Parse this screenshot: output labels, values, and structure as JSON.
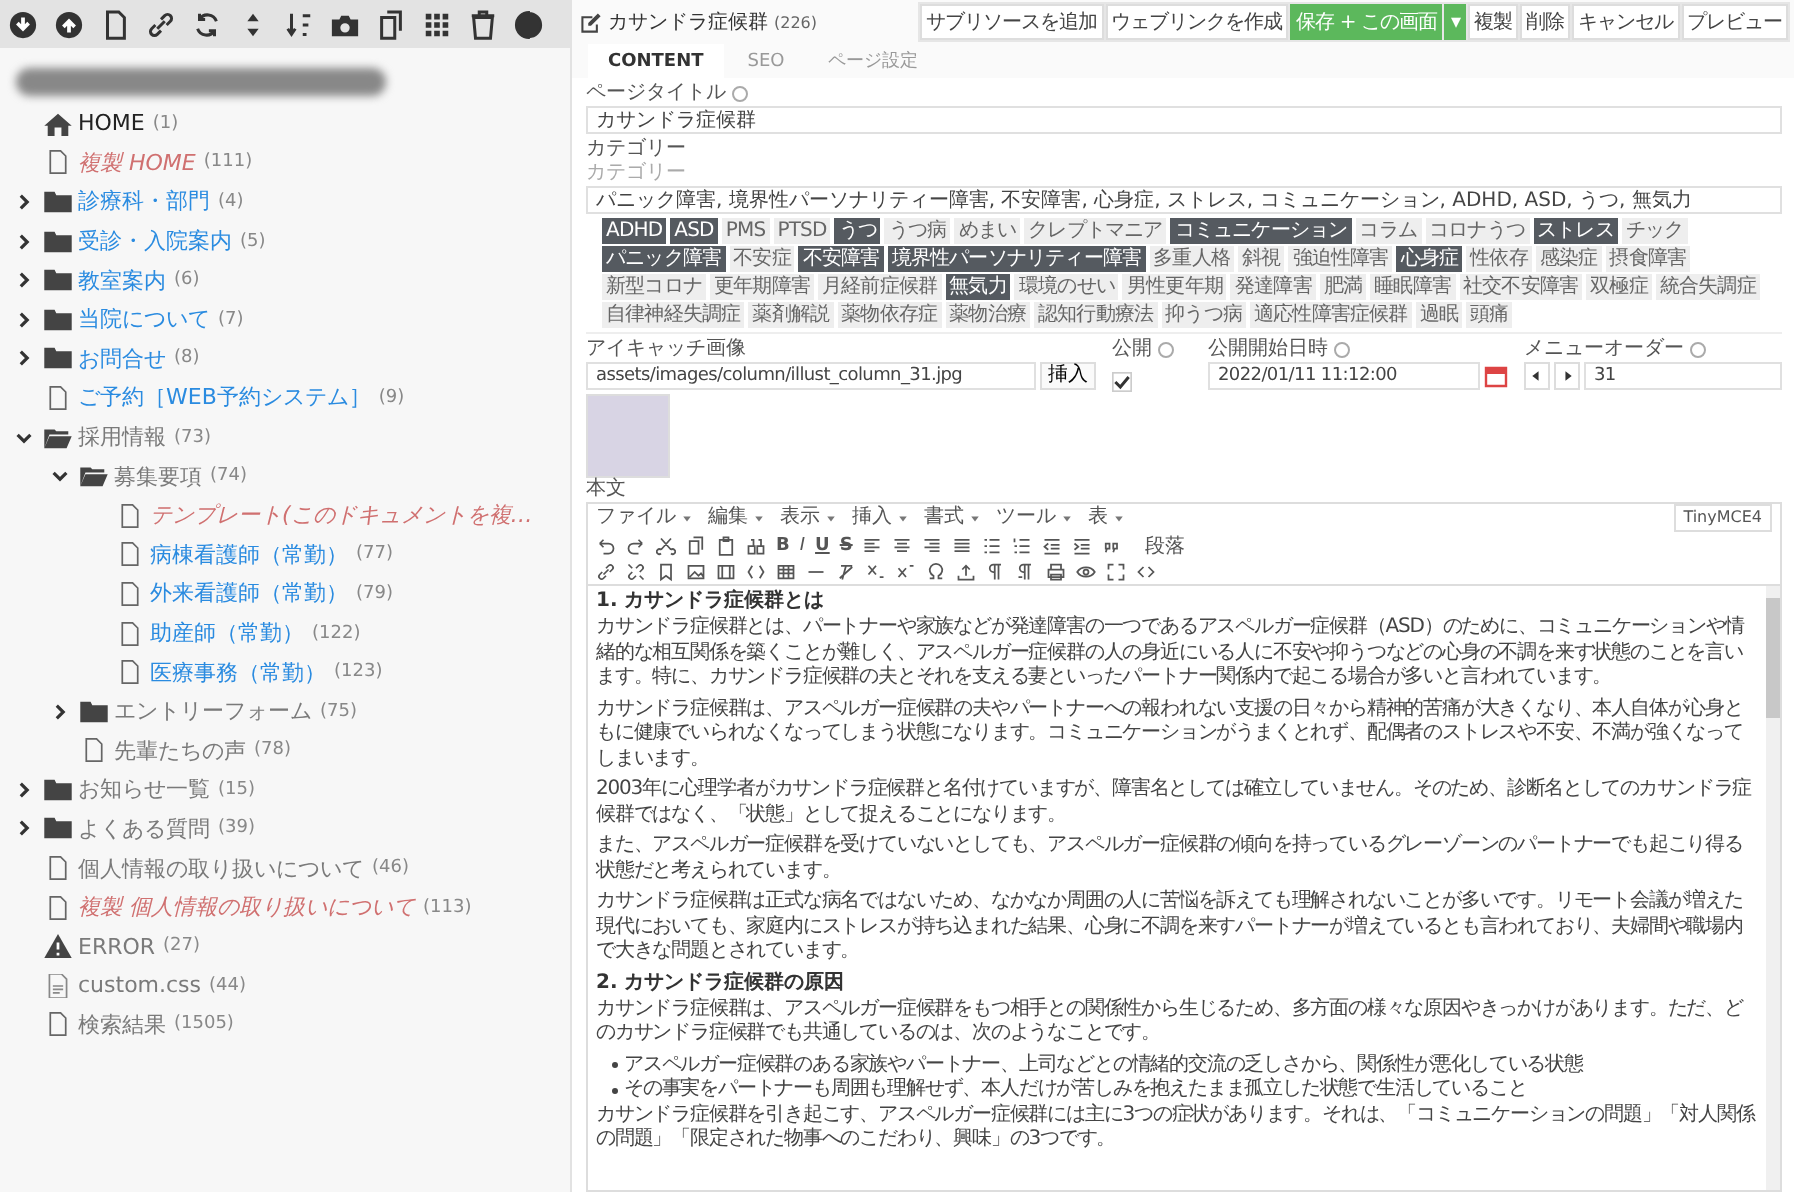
{
  "tree": [
    {
      "label": "HOME",
      "id": "(1)",
      "kind": "home",
      "unpublished": false,
      "hidden": false
    },
    {
      "label": "複製 HOME",
      "id": "(111)",
      "kind": "doc",
      "unpublished": true,
      "hidden": false
    },
    {
      "label": "診療科・部門",
      "id": "(4)",
      "kind": "folder",
      "unpublished": false,
      "hidden": false,
      "expanded": false
    },
    {
      "label": "受診・入院案内",
      "id": "(5)",
      "kind": "folder",
      "unpublished": false,
      "hidden": false,
      "expanded": false
    },
    {
      "label": "教室案内",
      "id": "(6)",
      "kind": "folder",
      "unpublished": false,
      "hidden": false,
      "expanded": false
    },
    {
      "label": "当院について",
      "id": "(7)",
      "kind": "folder",
      "unpublished": false,
      "hidden": false,
      "expanded": false
    },
    {
      "label": "お問合せ",
      "id": "(8)",
      "kind": "folder",
      "unpublished": false,
      "hidden": false,
      "expanded": false
    },
    {
      "label": "ご予約［WEB予約システム］",
      "id": "(9)",
      "kind": "doc",
      "unpublished": false,
      "hidden": false
    },
    {
      "label": "採用情報",
      "id": "(73)",
      "kind": "folder",
      "unpublished": false,
      "hidden": true,
      "expanded": true,
      "children": [
        {
          "label": "募集要項",
          "id": "(74)",
          "kind": "folder",
          "unpublished": false,
          "hidden": true,
          "expanded": true,
          "children": [
            {
              "label": "テンプレート(このドキュメントを複…",
              "kind": "doc",
              "unpublished": true,
              "hidden": false
            },
            {
              "label": "病棟看護師（常勤）",
              "id": "(77)",
              "kind": "doc",
              "unpublished": false,
              "hidden": false
            },
            {
              "label": "外来看護師（常勤）",
              "id": "(79)",
              "kind": "doc",
              "unpublished": false,
              "hidden": false
            },
            {
              "label": "助産師（常勤）",
              "id": "(122)",
              "kind": "doc",
              "unpublished": false,
              "hidden": false
            },
            {
              "label": "医療事務（常勤）",
              "id": "(123)",
              "kind": "doc",
              "unpublished": false,
              "hidden": false
            }
          ]
        },
        {
          "label": "エントリーフォーム",
          "id": "(75)",
          "kind": "folder",
          "unpublished": false,
          "hidden": true,
          "expanded": false
        },
        {
          "label": "先輩たちの声",
          "id": "(78)",
          "kind": "doc",
          "unpublished": false,
          "hidden": true
        }
      ]
    },
    {
      "label": "お知らせ一覧",
      "id": "(15)",
      "kind": "folder",
      "unpublished": false,
      "hidden": true,
      "expanded": false
    },
    {
      "label": "よくある質問",
      "id": "(39)",
      "kind": "folder",
      "unpublished": false,
      "hidden": true,
      "expanded": false
    },
    {
      "label": "個人情報の取り扱いについて",
      "id": "(46)",
      "kind": "doc",
      "unpublished": false,
      "hidden": true
    },
    {
      "label": "複製 個人情報の取り扱いについて",
      "id": "(113)",
      "kind": "doc",
      "unpublished": true,
      "hidden": false
    },
    {
      "label": "ERROR",
      "id": "(27)",
      "kind": "error",
      "unpublished": false,
      "hidden": true
    },
    {
      "label": "custom.css",
      "id": "(44)",
      "kind": "file",
      "unpublished": false,
      "hidden": true
    },
    {
      "label": "検索結果",
      "id": "(1505)",
      "kind": "doc",
      "unpublished": false,
      "hidden": true
    }
  ],
  "header": {
    "title": "カサンドラ症候群",
    "id": "(226)"
  },
  "actions": [
    {
      "label": "サブリソースを追加",
      "kind": "plain"
    },
    {
      "label": "ウェブリンクを作成",
      "kind": "plain"
    },
    {
      "label": "保存 + この画面",
      "kind": "primary"
    },
    {
      "label": "▾",
      "kind": "primary"
    },
    {
      "label": "複製",
      "kind": "plain"
    },
    {
      "label": "削除",
      "kind": "plain"
    },
    {
      "label": "キャンセル",
      "kind": "plain"
    },
    {
      "label": "プレビュー",
      "kind": "plain"
    }
  ],
  "tabs": [
    {
      "label": "CONTENT",
      "selected": true
    },
    {
      "label": "SEO",
      "selected": false
    },
    {
      "label": "ページ設定",
      "selected": false
    }
  ],
  "page_title": {
    "label": "ページタイトル",
    "value": "カサンドラ症候群"
  },
  "category": {
    "label": "カテゴリー",
    "sublabel": "カテゴリー",
    "value": "パニック障害, 境界性パーソナリティー障害, 不安障害, 心身症, ストレス, コミュニケーション, ADHD, ASD, うつ, 無気力",
    "tags": [
      {
        "label": "ADHD",
        "selected": true
      },
      {
        "label": "ASD",
        "selected": true
      },
      {
        "label": "PMS",
        "selected": false
      },
      {
        "label": "PTSD",
        "selected": false
      },
      {
        "label": "うつ",
        "selected": true
      },
      {
        "label": "うつ病",
        "selected": false
      },
      {
        "label": "めまい",
        "selected": false
      },
      {
        "label": "クレプトマニア",
        "selected": false
      },
      {
        "label": "コミュニケーション",
        "selected": true
      },
      {
        "label": "コラム",
        "selected": false
      },
      {
        "label": "コロナうつ",
        "selected": false
      },
      {
        "label": "ストレス",
        "selected": true
      },
      {
        "label": "チック",
        "selected": false
      },
      {
        "label": "パニック障害",
        "selected": true
      },
      {
        "label": "不安症",
        "selected": false
      },
      {
        "label": "不安障害",
        "selected": true
      },
      {
        "label": "境界性パーソナリティー障害",
        "selected": true
      },
      {
        "label": "多重人格",
        "selected": false
      },
      {
        "label": "斜視",
        "selected": false
      },
      {
        "label": "強迫性障害",
        "selected": false
      },
      {
        "label": "心身症",
        "selected": true
      },
      {
        "label": "性依存",
        "selected": false
      },
      {
        "label": "感染症",
        "selected": false
      },
      {
        "label": "摂食障害",
        "selected": false
      },
      {
        "label": "新型コロナ",
        "selected": false
      },
      {
        "label": "更年期障害",
        "selected": false
      },
      {
        "label": "月経前症候群",
        "selected": false
      },
      {
        "label": "無気力",
        "selected": true
      },
      {
        "label": "環境のせい",
        "selected": false
      },
      {
        "label": "男性更年期",
        "selected": false
      },
      {
        "label": "発達障害",
        "selected": false
      },
      {
        "label": "肥満",
        "selected": false
      },
      {
        "label": "睡眠障害",
        "selected": false
      },
      {
        "label": "社交不安障害",
        "selected": false
      },
      {
        "label": "双極症",
        "selected": false
      },
      {
        "label": "統合失調症",
        "selected": false
      },
      {
        "label": "自律神経失調症",
        "selected": false
      },
      {
        "label": "薬剤解説",
        "selected": false
      },
      {
        "label": "薬物依存症",
        "selected": false
      },
      {
        "label": "薬物治療",
        "selected": false
      },
      {
        "label": "認知行動療法",
        "selected": false
      },
      {
        "label": "抑うつ病",
        "selected": false
      },
      {
        "label": "適応性障害症候群",
        "selected": false
      },
      {
        "label": "過眠",
        "selected": false
      },
      {
        "label": "頭痛",
        "selected": false
      }
    ]
  },
  "image": {
    "label": "アイキャッチ画像",
    "value": "assets/images/column/illust_column_31.jpg",
    "button": "挿入"
  },
  "published": {
    "label": "公開",
    "checked": true
  },
  "pub_date": {
    "label": "公開開始日時",
    "value": "2022/01/11 11:12:00"
  },
  "menu_order": {
    "label": "メニューオーダー",
    "value": "31"
  },
  "editor": {
    "label": "本文",
    "menus": [
      "ファイル",
      "編集",
      "表示",
      "挿入",
      "書式",
      "ツール",
      "表"
    ],
    "switcher": "TinyMCE4",
    "format": "段落",
    "text_tools": [
      "B",
      "I",
      "U",
      "S"
    ],
    "content": [
      {
        "kind": "h",
        "text": "1. カサンドラ症候群とは"
      },
      {
        "kind": "p",
        "text": "カサンドラ症候群とは、パートナーや家族などが発達障害の一つであるアスペルガー症候群（ASD）のために、コミュニケーションや情緒的な相互関係を築くことが難しく、アスペルガー症候群の人の身近にいる人に不安や抑うつなどの心身の不調を来す状態のことを言います。特に、カサンドラ症候群の夫とそれを支える妻といったパートナー関係内で起こる場合が多いと言われています。"
      },
      {
        "kind": "p",
        "text": "カサンドラ症候群は、アスペルガー症候群の夫やパートナーへの報われない支援の日々から精神的苦痛が大きくなり、本人自体が心身ともに健康でいられなくなってしまう状態になります。コミュニケーションがうまくとれず、配偶者のストレスや不安、不満が強くなってしまいます。"
      },
      {
        "kind": "p",
        "text": "2003年に心理学者がカサンドラ症候群と名付けていますが、障害名としては確立していません。そのため、診断名としてのカサンドラ症候群ではなく、「状態」として捉えることになります。"
      },
      {
        "kind": "p",
        "text": "また、アスペルガー症候群を受けていないとしても、アスペルガー症候群の傾向を持っているグレーゾーンのパートナーでも起こり得る状態だと考えられています。"
      },
      {
        "kind": "p",
        "text": "カサンドラ症候群は正式な病名ではないため、なかなか周囲の人に苦悩を訴えても理解されないことが多いです。リモート会議が増えた現代においても、家庭内にストレスが持ち込まれた結果、心身に不調を来すパートナーが増えているとも言われており、夫婦間や職場内で大きな問題とされています。"
      },
      {
        "kind": "h",
        "text": "2. カサンドラ症候群の原因"
      },
      {
        "kind": "p",
        "text": "カサンドラ症候群は、アスペルガー症候群をもつ相手との関係性から生じるため、多方面の様々な原因やきっかけがあります。ただ、どのカサンドラ症候群でも共通しているのは、次のようなことです。"
      },
      {
        "kind": "li",
        "text": "アスペルガー症候群のある家族やパートナー、上司などとの情緒的交流の乏しさから、関係性が悪化している状態"
      },
      {
        "kind": "li",
        "text": "その事実をパートナーも周囲も理解せず、本人だけが苦しみを抱えたまま孤立した状態で生活していること"
      },
      {
        "kind": "p",
        "text": "カサンドラ症候群を引き起こす、アスペルガー症候群には主に3つの症状があります。それは、「コミュニケーションの問題」「対人関係の問題」「限定された物事へのこだわり、興味」の3つです。"
      }
    ]
  }
}
